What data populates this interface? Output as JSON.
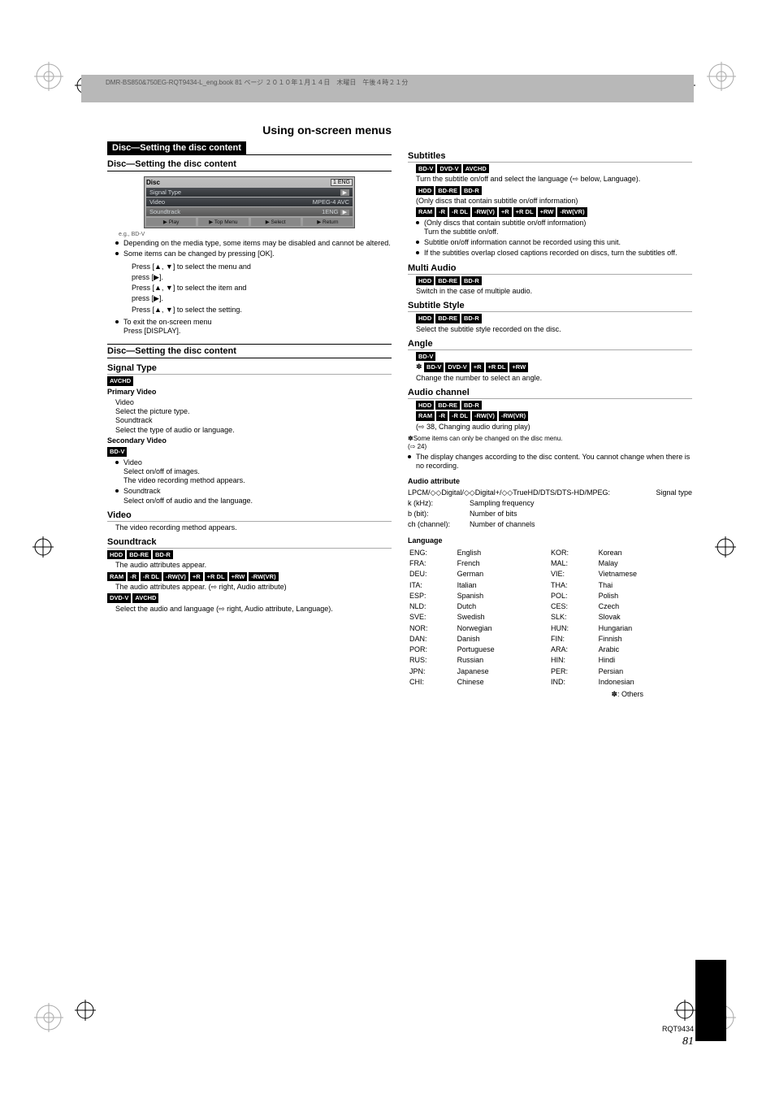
{
  "print_header": "DMR-BS850&750EG-RQT9434-L_eng.book  81 ページ  ２０１０年１月１４日　木曜日　午後４時２１分",
  "header": {
    "black": "Disc—Setting the disc content",
    "sub": "Disc—Setting the disc content"
  },
  "menu_mock": {
    "title": "Disc",
    "lock": "1 ENG",
    "rows": [
      {
        "label": "Signal Type",
        "arrow": true
      },
      {
        "label": "Video",
        "value": "MPEG-4 AVC"
      }
    ],
    "selrow": {
      "label": "Soundtrack",
      "value1": "1ENG",
      "icon": "▶"
    },
    "footer": [
      "▶  Play",
      "▶  Top Menu",
      "▶  Select",
      "▶  Return"
    ],
    "note": "e.g., BD-V"
  },
  "left": {
    "bullets1": [
      "Depending on the media type, some items may be disabled and cannot be altered.",
      "Some items can be changed by pressing [OK]."
    ],
    "nav": [
      {
        "prefix": "Press [",
        "icons": "▲, ▼",
        "suffix": "] to select the menu and"
      },
      {
        "prefix": "press [",
        "icons": "▶",
        "suffix": "]."
      },
      {
        "prefix": "Press [",
        "icons": "▲, ▼",
        "suffix": "] to select the item and"
      },
      {
        "prefix": "press [",
        "icons": "▶",
        "suffix": "]."
      },
      {
        "prefix": "Press [",
        "icons": "▲, ▼",
        "suffix": "] to select the setting."
      }
    ],
    "exit_bullet": "To exit the on-screen menu\nPress [DISPLAY].",
    "sec2_sub": "Disc—Setting the disc content",
    "signal_type": {
      "title": "Signal Type",
      "primary": {
        "title": "Primary Video",
        "body": "Video\nSelect the picture type.\nSoundtrack\nSelect the type of audio or language."
      },
      "secondary": {
        "title": "Secondary Video",
        "body_lines": [
          "Video",
          "Select on/off of images.",
          "The video recording method appears.",
          "Soundtrack",
          "Select on/off of audio and the language."
        ]
      }
    },
    "video_title": "Video",
    "video_body": "The video recording method appears.",
    "soundtrack_title": "Soundtrack",
    "sound_blocks": [
      {
        "badges": [
          "HDD",
          "BD-RE",
          "BD-R"
        ],
        "text": "The audio attributes appear."
      },
      {
        "badges": [
          "RAM",
          "-R",
          "-R DL",
          "-RW(V)",
          "+R",
          "+R DL",
          "+RW",
          "-RW(VR)"
        ],
        "text": "The audio attributes appear. (⇨ right, Audio attribute)"
      },
      {
        "badges": [
          "DVD-V",
          "AVCHD"
        ],
        "text": "Select the audio and language (⇨ right, Audio attribute, Language)."
      }
    ]
  },
  "right": {
    "subtitles_title": "Subtitles",
    "sub_blocks": [
      {
        "badges": [
          "BD-V",
          "DVD-V",
          "AVCHD"
        ],
        "text": "Turn the subtitle on/off and select the language (⇨ below, Language)."
      },
      {
        "badges": [
          "HDD",
          "BD-RE",
          "BD-R"
        ],
        "text": "(Only discs that contain subtitle on/off information)"
      },
      {
        "badges": [
          "RAM",
          "-R",
          "-R DL",
          "-RW(V)",
          "+R",
          "+R DL",
          "+RW",
          "-RW(VR)"
        ],
        "bullets": [
          "(Only discs that contain subtitle on/off information)\nTurn the subtitle on/off.",
          "Subtitle on/off information cannot be recorded using this unit.",
          "If the subtitles overlap closed captions recorded on discs, turn the subtitles off."
        ]
      }
    ],
    "multi_title": "Multi Audio",
    "multi_body": "Switch in the case of multiple audio.",
    "substyle_title": "Subtitle Style",
    "substyle_body": "Select the subtitle style recorded on the disc.",
    "angle_title": "Angle",
    "angle_body": "Change the number to select an angle.",
    "ch_title": "Audio channel",
    "ch_body": "(⇨ 38, Changing audio during play)",
    "note": "Some items can only be changed on the disc menu.\n(⇨ 24)",
    "note_bullet": "The display changes according to the disc content. You cannot change when there is no recording.",
    "attr_title": "Audio attribute",
    "attr_body": "LPCM/◇◇Digital/◇◇Digital+/◇◇TrueHD/DTS/DTS-HD/MPEG:",
    "attr_k": "k (kHz):",
    "attr_k_v": "Sampling frequency",
    "attr_b": "b (bit):",
    "attr_b_v": "Number of bits",
    "attr_ch": "ch (channel):",
    "attr_ch_v": "Number of channels",
    "lang_title": "Language",
    "lang_table": [
      [
        "ENG:",
        "English",
        "KOR:",
        "Korean"
      ],
      [
        "FRA:",
        "French",
        "MAL:",
        "Malay"
      ],
      [
        "DEU:",
        "German",
        "VIE:",
        "Vietnamese"
      ],
      [
        "ITA:",
        "Italian",
        "THA:",
        "Thai"
      ],
      [
        "ESP:",
        "Spanish",
        "POL:",
        "Polish"
      ],
      [
        "NLD:",
        "Dutch",
        "CES:",
        "Czech"
      ],
      [
        "SVE:",
        "Swedish",
        "SLK:",
        "Slovak"
      ],
      [
        "NOR:",
        "Norwegian",
        "HUN:",
        "Hungarian"
      ],
      [
        "DAN:",
        "Danish",
        "FIN:",
        "Finnish"
      ],
      [
        "POR:",
        "Portuguese",
        "ARA:",
        "Arabic"
      ],
      [
        "RUS:",
        "Russian",
        "HIN:",
        "Hindi"
      ],
      [
        "JPN:",
        "Japanese",
        "PER:",
        "Persian"
      ],
      [
        "CHI:",
        "Chinese",
        "IND:",
        "Indonesian"
      ]
    ],
    "lang_foot": "✽: Others",
    "attr_right": "Signal type"
  },
  "multi_badges": [
    "HDD",
    "BD-RE",
    "BD-R"
  ],
  "substyle_badges": [
    "HDD",
    "BD-RE",
    "BD-R"
  ],
  "angle_badges": [
    "BD-V"
  ],
  "angle_badges2": [
    "BD-V",
    "DVD-V",
    "+R",
    "+R DL",
    "+RW"
  ],
  "ch_badges1": [
    "HDD",
    "BD-RE",
    "BD-R"
  ],
  "ch_badges2": [
    "RAM",
    "-R",
    "-R DL",
    "-RW(V)",
    "-RW(VR)"
  ],
  "footer": {
    "rqt": "RQT9434",
    "page": "81"
  },
  "section_title_right": "Using on-screen menus"
}
